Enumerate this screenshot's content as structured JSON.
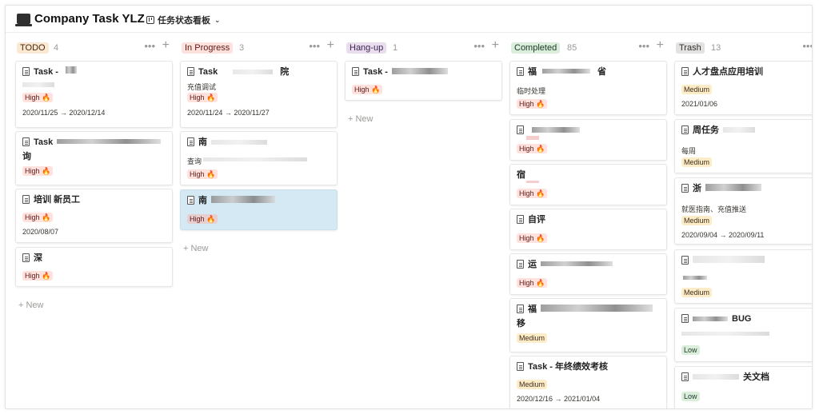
{
  "header": {
    "title": "Company Task YLZ",
    "view_label": "任务状态看板",
    "view_chevron": "⌄"
  },
  "colors": {
    "todo": "#fbe8d3",
    "in_progress": "#ffe2dd",
    "hang_up": "#e8deee",
    "completed": "#dbeddb",
    "trash": "#e3e2e0",
    "selected_card": "#d5e9f4"
  },
  "new_label": "+ New",
  "columns": {
    "todo": {
      "label": "TODO",
      "count": "4",
      "cards": [
        {
          "title": "Task -",
          "sub": "",
          "badge": "High 🔥",
          "date": "2020/11/25 → 2020/12/14"
        },
        {
          "title": "Task",
          "title2": "询",
          "badge": "High 🔥"
        },
        {
          "title": "培训 新员工",
          "badge": "High 🔥",
          "date": "2020/08/07"
        },
        {
          "title": "深",
          "badge": "High 🔥"
        }
      ]
    },
    "in_progress": {
      "label": "In Progress",
      "count": "3",
      "cards": [
        {
          "title": "Task",
          "title_tail": "院",
          "sub": "充值调试",
          "badge": "High 🔥",
          "date": "2020/11/24 → 2020/11/27"
        },
        {
          "title": "南",
          "sub": "查询",
          "badge": "High 🔥"
        },
        {
          "title": "南",
          "badge": "High 🔥"
        }
      ]
    },
    "hang_up": {
      "label": "Hang-up",
      "count": "1",
      "cards": [
        {
          "title": "Task -",
          "badge": "High 🔥"
        }
      ]
    },
    "completed": {
      "label": "Completed",
      "count": "85",
      "cards": [
        {
          "title": "福",
          "title_tail": "省",
          "sub": "临时处理",
          "badge": "High 🔥"
        },
        {
          "title": "",
          "badge": "High 🔥"
        },
        {
          "title": "宿",
          "badge": "High 🔥"
        },
        {
          "title": "自评",
          "badge": "High 🔥"
        },
        {
          "title": "运",
          "badge": "High 🔥"
        },
        {
          "title": "福",
          "title2": "移",
          "badge": "Medium"
        },
        {
          "title": "Task - 年终绩效考核",
          "badge": "Medium",
          "date": "2020/12/16 → 2021/01/04"
        }
      ]
    },
    "trash": {
      "label": "Trash",
      "count": "13",
      "cards": [
        {
          "title": "人才盘点应用培训",
          "badge": "Medium",
          "date": "2021/01/06"
        },
        {
          "title": "周任务",
          "sub": "每周",
          "badge": "Medium"
        },
        {
          "title": "浙",
          "sub": "就医指南、充值推送",
          "badge": "Medium",
          "date": "2020/09/04 → 2020/09/11"
        },
        {
          "title": "",
          "badge": "Medium"
        },
        {
          "title": "BUG",
          "badge": "Low"
        },
        {
          "title": "关文档",
          "badge": "Low"
        }
      ]
    }
  }
}
